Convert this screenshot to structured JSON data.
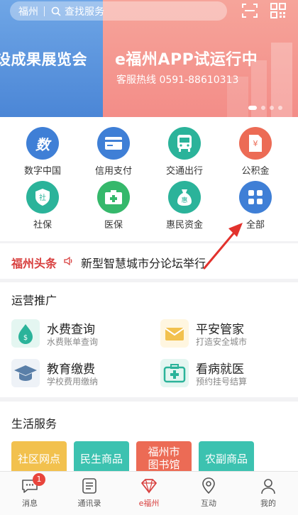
{
  "search": {
    "city": "福州",
    "placeholder": "查找服务"
  },
  "banner": {
    "left_text": "设成果展览会",
    "title": "e福州APP试运行中",
    "hotline": "客服热线 0591-88610313"
  },
  "services": [
    {
      "label": "数字中国",
      "icon": "digital-china-icon",
      "color": "#3f7fd6"
    },
    {
      "label": "信用支付",
      "icon": "credit-card-icon",
      "color": "#3f7fd6"
    },
    {
      "label": "交通出行",
      "icon": "bus-icon",
      "color": "#2bb39a"
    },
    {
      "label": "公积金",
      "icon": "housing-fund-icon",
      "color": "#ec6b55"
    },
    {
      "label": "社保",
      "icon": "social-security-icon",
      "color": "#2bb39a"
    },
    {
      "label": "医保",
      "icon": "medical-insurance-icon",
      "color": "#35b86b"
    },
    {
      "label": "惠民资金",
      "icon": "money-bag-icon",
      "color": "#2bb39a"
    },
    {
      "label": "全部",
      "icon": "grid-icon",
      "color": "#3f7fd6"
    }
  ],
  "headline": {
    "brand": "福州头条",
    "text": "新型智慧城市分论坛举行"
  },
  "operations": {
    "title": "运营推广",
    "items": [
      {
        "title": "水费查询",
        "subtitle": "水费账单查询",
        "icon": "water-drop-icon"
      },
      {
        "title": "平安管家",
        "subtitle": "打造安全城市",
        "icon": "mail-icon"
      },
      {
        "title": "教育缴费",
        "subtitle": "学校费用缴纳",
        "icon": "graduation-cap-icon"
      },
      {
        "title": "看病就医",
        "subtitle": "预约挂号结算",
        "icon": "medical-kit-icon"
      }
    ]
  },
  "life": {
    "title": "生活服务",
    "cards": [
      {
        "label": "社区网点",
        "color": "#f2c14e"
      },
      {
        "label": "民生商品",
        "color": "#3cc2b0"
      },
      {
        "label": "福州市图书馆",
        "color": "#ec6b55"
      },
      {
        "label": "农副商品",
        "color": "#3cc2b0"
      }
    ]
  },
  "tabs": [
    {
      "label": "消息",
      "icon": "message-icon",
      "badge": "1"
    },
    {
      "label": "通讯录",
      "icon": "contacts-icon"
    },
    {
      "label": "e福州",
      "icon": "diamond-icon"
    },
    {
      "label": "互动",
      "icon": "location-pin-icon"
    },
    {
      "label": "我的",
      "icon": "user-icon"
    }
  ]
}
